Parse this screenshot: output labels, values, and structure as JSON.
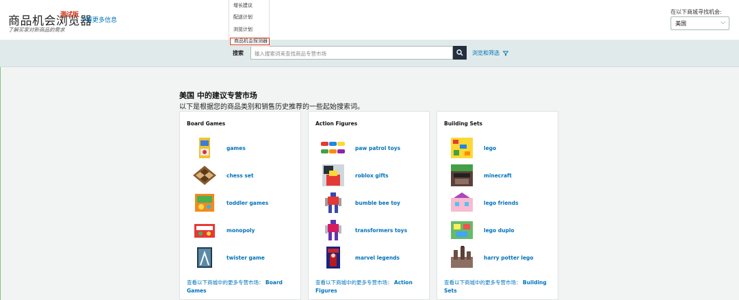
{
  "header": {
    "title": "商品机会浏览器",
    "beta": "测试版",
    "learn_more": "了解更多信息",
    "subtitle": "了解买家对新商品的需求"
  },
  "menu": {
    "items": [
      "增长建议",
      "配送计划",
      "浏览计划",
      "商品机会探测器"
    ]
  },
  "marketplace": {
    "label": "在以下商城寻找机会:",
    "selected": "美国"
  },
  "search": {
    "label": "搜索",
    "placeholder": "输入搜索词来查找商品专营市场",
    "browse_label": "浏览和筛选"
  },
  "main": {
    "heading": "美国 中的建议专营市场",
    "subheading": "以下是根据您的商品类别和销售历史推荐的一些起始搜索词。"
  },
  "cards": [
    {
      "title": "Board Games",
      "keywords": [
        "games",
        "chess set",
        "toddler games",
        "monopoly",
        "twister game"
      ],
      "footer_prefix": "查看以下商城中的更多专营市场：",
      "footer_category": "Board Games"
    },
    {
      "title": "Action Figures",
      "keywords": [
        "paw patrol toys",
        "roblox gifts",
        "bumble bee toy",
        "transformers toys",
        "marvel legends"
      ],
      "footer_prefix": "查看以下商城中的更多专营市场：",
      "footer_category": "Action Figures"
    },
    {
      "title": "Building Sets",
      "keywords": [
        "lego",
        "minecraft",
        "lego friends",
        "lego duplo",
        "harry potter lego"
      ],
      "footer_prefix": "查看以下商城中的更多专营市场：",
      "footer_category": "Building Sets"
    }
  ],
  "colors": {
    "link": "#0073bb",
    "accent_red": "#d13212",
    "search_bg": "#e1eaea",
    "dark_button": "#232f3e"
  }
}
